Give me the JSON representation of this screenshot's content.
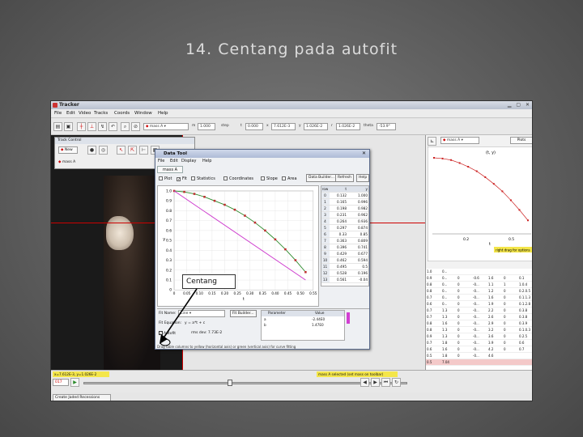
{
  "slide": {
    "title": "14. Centang pada autofit"
  },
  "app": {
    "title": "Tracker",
    "menu": [
      "File",
      "Edit",
      "Video",
      "Tracks",
      "Coords",
      "Window",
      "Help"
    ],
    "toolbar": {
      "track_select": "mass A",
      "m_label": "m",
      "m_value": "1.000",
      "step_label": "step",
      "t_label": "t",
      "t_value": "0.000",
      "x_label": "x",
      "x_value": "7.612E-3",
      "y_label": "y",
      "y_value": "1.026E-2",
      "r_label": "r",
      "r_value": "1.026E-2",
      "theta_label": "theta",
      "theta_value": "-53.9°"
    },
    "track_control": {
      "title": "Track Control",
      "new_label": "New",
      "track_item": "mass A"
    },
    "plot_panel": {
      "track_select": "mass A",
      "plots_button": "Plots",
      "plot_title": "(t, y)",
      "x_axis": "t",
      "x_ticks": [
        "0.2",
        "0.5"
      ],
      "hint": "right drag for options"
    },
    "data_table_rows": [
      [
        "1.0",
        "0...",
        "",
        "",
        "",
        "",
        ""
      ],
      [
        "0.9",
        "0...",
        "0",
        "-0.6",
        "1.6",
        "0",
        "0.1"
      ],
      [
        "0.8",
        "0...",
        "0",
        "-0...",
        "1.1",
        "1",
        "1.0.4"
      ],
      [
        "0.8",
        "0...",
        "0",
        "-0...",
        "1.2",
        "0",
        "0.2.0.5"
      ],
      [
        "0.7",
        "0...",
        "0",
        "-0...",
        "1.6",
        "0",
        "0.1.1.3"
      ],
      [
        "0.6",
        "0...",
        "0",
        "-0...",
        "1.9",
        "0",
        "0.1.2.8"
      ],
      [
        "0.7",
        "1.3",
        "0",
        "-0...",
        "2.2",
        "0",
        "0.3.8"
      ],
      [
        "0.7",
        "1.3",
        "0",
        "-0...",
        "2.6",
        "0",
        "0.3.8"
      ],
      [
        "0.8",
        "1.6",
        "0",
        "-0...",
        "2.9",
        "0",
        "0.3.9"
      ],
      [
        "0.8",
        "1.3",
        "0",
        "-0...",
        "3.2",
        "0",
        "0.1.0.3"
      ],
      [
        "0.9",
        "1.3",
        "0",
        "-0...",
        "3.6",
        "0",
        "0.2.5"
      ],
      [
        "0.7",
        "1.8",
        "0",
        "-0...",
        "3.9",
        "0",
        "0.6"
      ],
      [
        "0.6",
        "1.6",
        "0",
        "-0...",
        "4.2",
        "0",
        "0.7"
      ],
      [
        "0.5",
        "1.8",
        "0",
        "-0...",
        "4.6",
        "",
        ""
      ],
      [
        "0.5",
        "7.04",
        "",
        "",
        "",
        "",
        ""
      ]
    ],
    "status": {
      "coords": "x=7.612E-3, y=1.026E-2",
      "frame": "017",
      "message": "mass A selected (set mass on toolbar)",
      "bottom_tab": "Create Jaded Recessions"
    }
  },
  "data_tool": {
    "title": "Data Tool",
    "menu": [
      "File",
      "Edit",
      "Display",
      "Help"
    ],
    "tab": "mass A",
    "options": [
      {
        "label": "Plot",
        "checked": false
      },
      {
        "label": "Fit",
        "checked": true
      },
      {
        "label": "Statistics",
        "checked": false
      },
      {
        "label": "Coordinates",
        "checked": false
      },
      {
        "label": "Slope",
        "checked": false
      },
      {
        "label": "Area",
        "checked": false
      }
    ],
    "buttons": {
      "data_builder": "Data Builder...",
      "refresh": "Refresh",
      "help": "Help"
    },
    "table": {
      "headers": [
        "row",
        "t",
        "y"
      ],
      "rows": [
        [
          "0",
          "0.132",
          "1.000"
        ],
        [
          "1",
          "0.165",
          "0.996"
        ],
        [
          "2",
          "0.198",
          "0.982"
        ],
        [
          "3",
          "0.231",
          "0.962"
        ],
        [
          "4",
          "0.264",
          "0.936"
        ],
        [
          "5",
          "0.297",
          "0.874"
        ],
        [
          "6",
          "0.33",
          "0.85"
        ],
        [
          "7",
          "0.363",
          "0.809"
        ],
        [
          "8",
          "0.396",
          "0.741"
        ],
        [
          "9",
          "0.429",
          "0.677"
        ],
        [
          "10",
          "0.462",
          "0.594"
        ],
        [
          "11",
          "0.495",
          "0.5"
        ],
        [
          "12",
          "0.528",
          "0.196"
        ],
        [
          "13",
          "0.561",
          "-0.04"
        ]
      ]
    },
    "fit": {
      "fit_name_label": "Fit Name:",
      "fit_name_value": "Line",
      "fit_builder": "Fit Builder...",
      "fit_equation_label": "Fit Equation:",
      "fit_equation": "y = a*t + c",
      "autofit_label": "Autofit",
      "rms_dev": "rms dev: 7.73E-2",
      "param_header": "Parameter",
      "value_header": "Value",
      "params": [
        {
          "name": "a",
          "value": "-2.44E0"
        },
        {
          "name": "b",
          "value": "1.47E0"
        }
      ]
    },
    "hint": "Drag table columns to yellow (horizontal axis) or green (vertical axis) for curve fitting"
  },
  "callout": {
    "text": "Centang"
  },
  "chart_data": {
    "type": "scatter",
    "title": "",
    "xlabel": "t",
    "ylabel": "y",
    "xlim": [
      0.0,
      0.55
    ],
    "ylim": [
      0.0,
      1.0
    ],
    "x_ticks": [
      "0",
      "0.05",
      "0.10",
      "0.15",
      "0.20",
      "0.25",
      "0.30",
      "0.35",
      "0.40",
      "0.45",
      "0.50",
      "0.55"
    ],
    "y_ticks": [
      "0",
      "0.1",
      "0.2",
      "0.3",
      "0.4",
      "0.5",
      "0.6",
      "0.7",
      "0.8",
      "0.9",
      "1.0"
    ],
    "series": [
      {
        "name": "",
        "color": "#2a8a2a",
        "x": [
          0.0,
          0.04,
          0.08,
          0.12,
          0.16,
          0.2,
          0.24,
          0.28,
          0.32,
          0.36,
          0.4,
          0.44,
          0.48,
          0.52
        ],
        "y": [
          1.0,
          0.99,
          0.97,
          0.94,
          0.9,
          0.86,
          0.81,
          0.75,
          0.68,
          0.6,
          0.51,
          0.41,
          0.3,
          0.18
        ]
      },
      {
        "name": "",
        "color": "#cc33cc",
        "fit_line": true,
        "x": [
          0.0,
          0.52
        ],
        "y": [
          1.0,
          0.1
        ]
      }
    ]
  },
  "mini_chart": {
    "color": "#cc2222",
    "x": [
      0.0,
      0.05,
      0.1,
      0.15,
      0.2,
      0.25,
      0.3,
      0.35,
      0.4,
      0.45,
      0.5,
      0.55
    ],
    "y": [
      1.0,
      0.99,
      0.97,
      0.93,
      0.88,
      0.82,
      0.74,
      0.65,
      0.55,
      0.43,
      0.3,
      0.16
    ]
  }
}
